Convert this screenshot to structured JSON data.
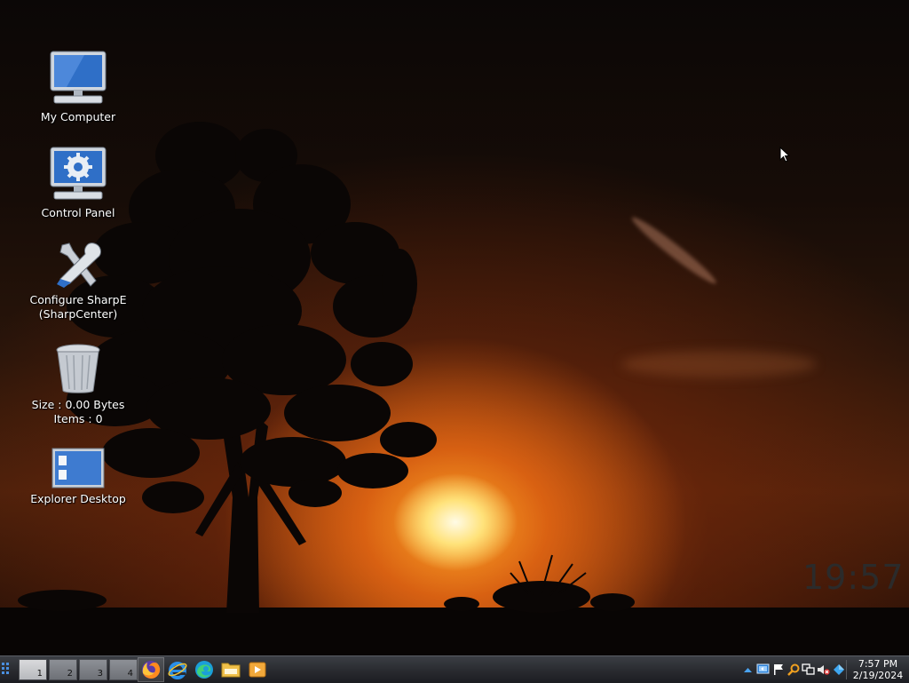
{
  "desktop": {
    "icons": [
      {
        "label": "My Computer",
        "icon": "computer-icon"
      },
      {
        "label": "Control Panel",
        "icon": "control-panel-icon"
      },
      {
        "label": "Configure SharpE",
        "label2": "(SharpCenter)",
        "icon": "tools-icon"
      },
      {
        "label": "Size : 0.00 Bytes",
        "label2": "Items : 0",
        "icon": "recycle-bin-icon"
      },
      {
        "label": "Explorer Desktop",
        "icon": "explorer-desktop-icon"
      }
    ],
    "clock_widget": "19:57"
  },
  "taskbar": {
    "workspaces": [
      "1",
      "2",
      "3",
      "4"
    ],
    "active_workspace": "1",
    "quick_launch": [
      "firefox-icon",
      "internet-explorer-icon",
      "edge-icon",
      "file-explorer-icon",
      "media-player-icon"
    ],
    "tray_icons": [
      "show-hidden-icons-arrow",
      "network-icon",
      "flag-icon",
      "search-icon",
      "monitor-icon",
      "volume-muted-icon",
      "windows-icon"
    ],
    "time": "7:57 PM",
    "date": "2/19/2024"
  },
  "colors": {
    "taskbar": "#2a2c31",
    "sun": "#ffe27a",
    "sky_glow": "#f06e14"
  }
}
